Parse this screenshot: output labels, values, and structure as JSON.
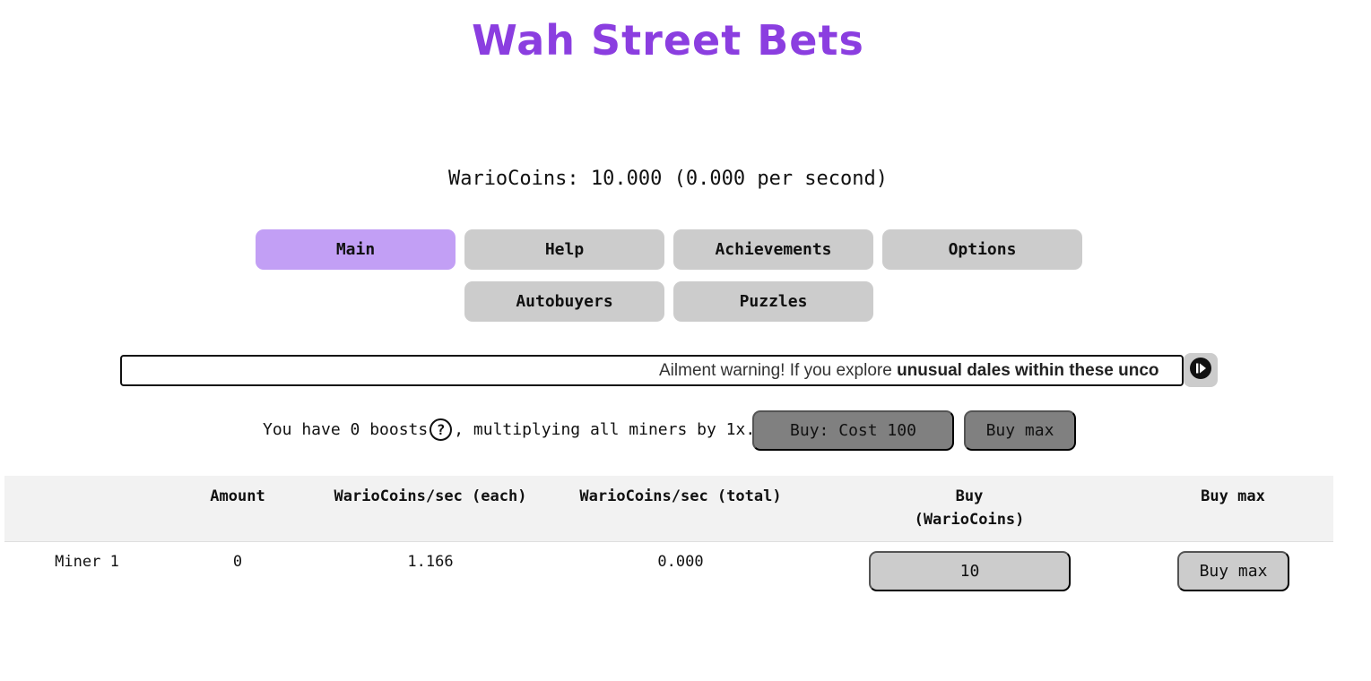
{
  "app": {
    "title": "Wah Street Bets"
  },
  "status": {
    "coins_text": "WarioCoins: 10.000 (0.000 per second)"
  },
  "tabs": [
    {
      "label": "Main",
      "active": true
    },
    {
      "label": "Help",
      "active": false
    },
    {
      "label": "Achievements",
      "active": false
    },
    {
      "label": "Options",
      "active": false
    },
    {
      "label": "Autobuyers",
      "active": false
    },
    {
      "label": "Puzzles",
      "active": false
    }
  ],
  "ticker": {
    "text_plain": "Ailment warning! If you explore ",
    "text_bold": "unusual dales within these unco",
    "button_icon": "play-pause-icon"
  },
  "boosts": {
    "text_before": "You have 0 boosts",
    "help_icon": "?",
    "text_after": ", multiplying all miners by 1x.",
    "buy_label": "Buy: Cost 100",
    "buy_max_label": "Buy max"
  },
  "table": {
    "headers": {
      "amount": "Amount",
      "each": "WarioCoins/sec (each)",
      "total": "WarioCoins/sec (total)",
      "buy_line1": "Buy",
      "buy_line2": "(WarioCoins)",
      "buy_max": "Buy max"
    },
    "rows": [
      {
        "name": "Miner 1",
        "amount": "0",
        "each": "1.166",
        "total": "0.000",
        "buy": "10",
        "buy_max": "Buy max"
      }
    ]
  },
  "colors": {
    "title": "#8b3ee0",
    "active_tab": "#c29ff5",
    "tab": "#cccccc",
    "dark_button": "#808080"
  }
}
